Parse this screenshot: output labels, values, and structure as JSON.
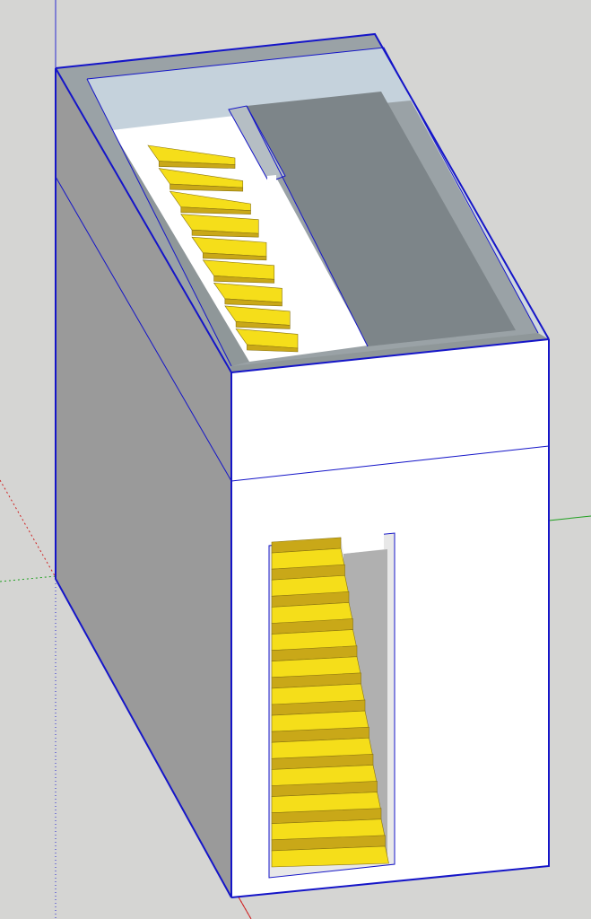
{
  "viewport": {
    "background": "#d5d5d3"
  },
  "colors": {
    "edge": "#1515c8",
    "side_face": "#9a9a9a",
    "front_face": "#ffffff",
    "front_face_dark": "#f2f2f2",
    "top_recess_back": "#c5d2dc",
    "floor_slab": "#7d8589",
    "stair_tread": "#f5de1a",
    "stair_riser": "#c9a818",
    "stair_shadow": "#e2c018",
    "axis_red": "#d02020",
    "axis_green": "#20a020",
    "axis_blue": "#2a2ad0"
  },
  "model": {
    "name": "stair-box-model",
    "upper_stair_steps": 9,
    "lower_stair_steps": 12
  }
}
